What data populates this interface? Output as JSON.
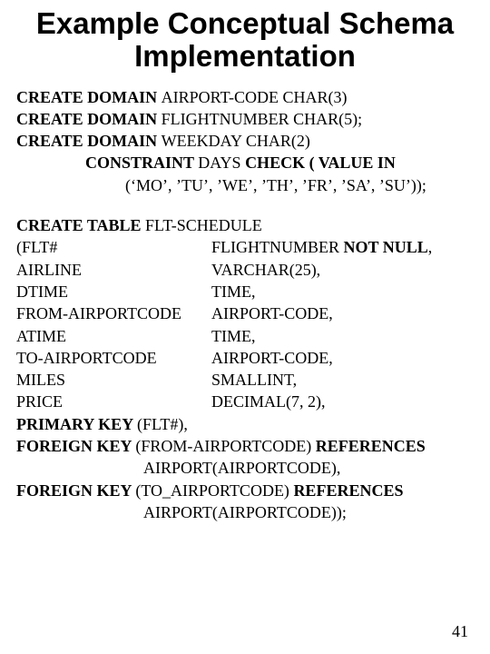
{
  "title": "Example Conceptual Schema Implementation",
  "domains": {
    "l1a": "CREATE DOMAIN ",
    "l1b": "AIRPORT-CODE CHAR(3)",
    "l2a": "CREATE DOMAIN ",
    "l2b": "FLIGHTNUMBER CHAR(5);",
    "l3a": "CREATE DOMAIN ",
    "l3b": "WEEKDAY CHAR(2)",
    "l4a": "CONSTRAINT ",
    "l4b": "DAYS  ",
    "l4c": "CHECK ( VALUE IN",
    "l5": "(‘MO’, ’TU’, ’WE’, ’TH’, ’FR’, ’SA’, ’SU’));"
  },
  "table": {
    "head_a": "CREATE TABLE ",
    "head_b": "FLT-SCHEDULE",
    "rows": [
      {
        "c1": "(FLT#",
        "c2a": "FLIGHTNUMBER ",
        "c2b": "NOT NULL",
        "c2c": ","
      },
      {
        "c1": "AIRLINE",
        "c2a": "VARCHAR(25),",
        "c2b": "",
        "c2c": ""
      },
      {
        "c1": "DTIME",
        "c2a": "TIME,",
        "c2b": "",
        "c2c": ""
      },
      {
        "c1": "FROM-AIRPORTCODE",
        "c2a": "AIRPORT-CODE,",
        "c2b": "",
        "c2c": ""
      },
      {
        "c1": "ATIME",
        "c2a": "TIME,",
        "c2b": "",
        "c2c": ""
      },
      {
        "c1": "TO-AIRPORTCODE",
        "c2a": "AIRPORT-CODE,",
        "c2b": "",
        "c2c": ""
      },
      {
        "c1": "MILES",
        "c2a": "SMALLINT,",
        "c2b": "",
        "c2c": ""
      },
      {
        "c1": "PRICE",
        "c2a": "DECIMAL(7, 2),",
        "c2b": "",
        "c2c": ""
      }
    ],
    "pk_a": "PRIMARY KEY ",
    "pk_b": "(FLT#),",
    "fk1_a": "FOREIGN KEY ",
    "fk1_b": "(FROM-AIRPORTCODE) ",
    "fk1_c": "REFERENCES",
    "fk1_d": "AIRPORT(AIRPORTCODE),",
    "fk2_a": "FOREIGN KEY ",
    "fk2_b": "(TO_AIRPORTCODE) ",
    "fk2_c": "REFERENCES",
    "fk2_d": "AIRPORT(AIRPORTCODE));"
  },
  "page_number": "41"
}
